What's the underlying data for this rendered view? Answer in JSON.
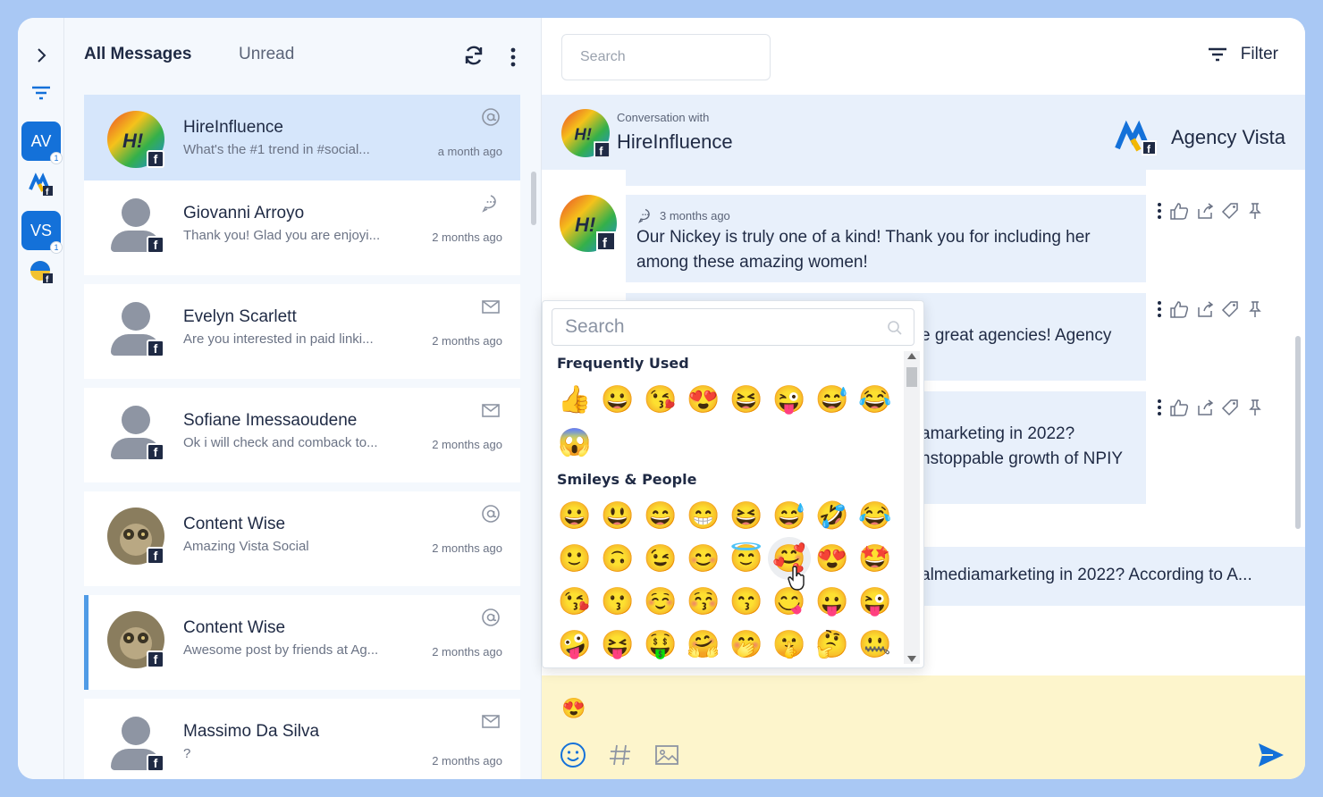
{
  "rail": {
    "accounts": [
      {
        "label": "AV",
        "count": "1"
      },
      {
        "label": "VS",
        "count": "1"
      }
    ]
  },
  "list": {
    "tabs": {
      "all": "All Messages",
      "unread": "Unread"
    },
    "conversations": [
      {
        "name": "HireInfluence",
        "snippet": "What's the #1 trend in #social...",
        "time": "a month ago",
        "kind": "mention-icon",
        "avatar": "logo"
      },
      {
        "name": "Giovanni Arroyo",
        "snippet": "Thank you! Glad you are enjoyi...",
        "time": "2 months ago",
        "kind": "comment-icon",
        "avatar": "person"
      },
      {
        "name": "Evelyn Scarlett",
        "snippet": "Are you interested in paid linki...",
        "time": "2 months ago",
        "kind": "mail-icon",
        "avatar": "person"
      },
      {
        "name": "Sofiane Imessaoudene",
        "snippet": "Ok i will check and comback to...",
        "time": "2 months ago",
        "kind": "mail-icon",
        "avatar": "person"
      },
      {
        "name": "Content Wise",
        "snippet": "Amazing Vista Social",
        "time": "2 months ago",
        "kind": "mention-icon",
        "avatar": "photo"
      },
      {
        "name": "Content Wise",
        "snippet": "Awesome post by friends at Ag...",
        "time": "2 months ago",
        "kind": "mention-icon",
        "avatar": "photo"
      },
      {
        "name": "Massimo Da Silva",
        "snippet": "?",
        "time": "2 months ago",
        "kind": "mail-icon",
        "avatar": "person"
      }
    ]
  },
  "topbar": {
    "search_placeholder": "Search",
    "filter_label": "Filter"
  },
  "conversation": {
    "subtitle": "Conversation with",
    "title": "HireInfluence",
    "brand": "Agency Vista",
    "messages": [
      {
        "time": "3 months ago",
        "text": "Our Nickey is truly one of a kind! Thank you for including her among these amazing women!"
      },
      {
        "time": "",
        "text": "e great agencies! Agency"
      },
      {
        "time": "",
        "text": "amarketing in 2022? nstoppable growth of NPIY"
      },
      {
        "time": "",
        "text": "almediamarketing in 2022? According to A..."
      }
    ]
  },
  "picker": {
    "search_placeholder": "Search",
    "frequent_title": "Frequently Used",
    "frequent": [
      "👍",
      "😀",
      "😘",
      "😍",
      "😆",
      "😜",
      "😅",
      "😂",
      "😱"
    ],
    "smileys_title": "Smileys & People",
    "smileys": [
      "😀",
      "😃",
      "😄",
      "😁",
      "😆",
      "😅",
      "🤣",
      "😂",
      "🙂",
      "🙃",
      "😉",
      "😊",
      "😇",
      "🥰",
      "😍",
      "🤩",
      "😘",
      "😗",
      "☺️",
      "😚",
      "😙",
      "😋",
      "😛",
      "😜",
      "🤪",
      "😝",
      "🤑",
      "🤗",
      "🤭",
      "🤫",
      "🤔",
      "🤐"
    ]
  },
  "composer": {
    "typed": "😍"
  },
  "colors": {
    "accent": "#1471d9",
    "selected": "#d6e6fb",
    "composer_bg": "#fdf5cc",
    "frame_bg": "#a9c8f4"
  }
}
